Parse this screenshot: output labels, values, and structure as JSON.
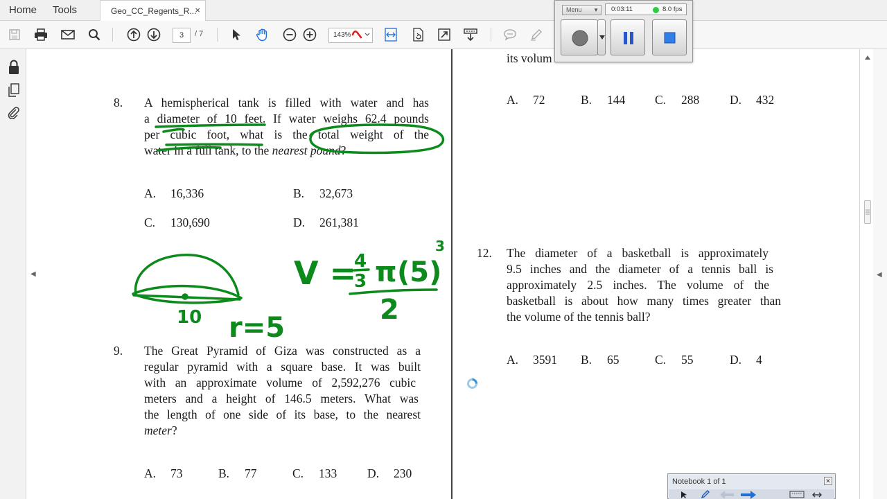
{
  "menu": {
    "home": "Home",
    "tools": "Tools"
  },
  "tab": {
    "title": "Geo_CC_Regents_R...",
    "close": "×"
  },
  "toolbar": {
    "page_current": "3",
    "page_total": "/ 7",
    "zoom": "143%"
  },
  "recorder": {
    "menu_label": "Menu",
    "elapsed": "0:03:11",
    "fps": "8.0 fps",
    "status_color": "#2ecc40"
  },
  "notebook": {
    "title": "Notebook 1 of 1"
  },
  "colors": {
    "ink_green": "#0c8a1c",
    "accent_blue": "#1e6fd9"
  },
  "questions": {
    "q8": {
      "number": "8.",
      "lines": [
        "A hemispherical tank is filled with water and has",
        "a diameter of 10 feet. If water weighs 62.4 pounds",
        "per cubic foot, what is the total weight of the"
      ],
      "last_line_prefix": "water in a full tank, to the ",
      "last_line_italic": "nearest pound",
      "last_line_suffix": "?",
      "options": [
        {
          "letter": "A.",
          "value": "16,336"
        },
        {
          "letter": "B.",
          "value": "32,673"
        },
        {
          "letter": "C.",
          "value": "130,690"
        },
        {
          "letter": "D.",
          "value": "261,381"
        }
      ]
    },
    "q9": {
      "number": "9.",
      "lines": [
        "The Great Pyramid of Giza was constructed as a",
        "regular pyramid with a square base. It was built",
        "with an approximate volume of 2,592,276 cubic",
        "meters and a height of 146.5 meters. What was",
        "the length of one side of its base, to the nearest"
      ],
      "last_line_italic": "meter",
      "last_line_suffix": "?",
      "options": [
        {
          "letter": "A.",
          "value": "73"
        },
        {
          "letter": "B.",
          "value": "77"
        },
        {
          "letter": "C.",
          "value": "133"
        },
        {
          "letter": "D.",
          "value": "230"
        }
      ]
    },
    "q11_tail": {
      "fragment": "its volum",
      "options": [
        {
          "letter": "A.",
          "value": "72"
        },
        {
          "letter": "B.",
          "value": "144"
        },
        {
          "letter": "C.",
          "value": "288"
        },
        {
          "letter": "D.",
          "value": "432"
        }
      ]
    },
    "q12": {
      "number": "12.",
      "lines": [
        "The diameter of a basketball is approximately",
        "9.5 inches and the diameter of a tennis ball is",
        "approximately 2.5 inches. The volume of the",
        "basketball is about how many times greater than"
      ],
      "last_line": "the volume of the tennis ball?",
      "options": [
        {
          "letter": "A.",
          "value": "3591"
        },
        {
          "letter": "B.",
          "value": "65"
        },
        {
          "letter": "C.",
          "value": "55"
        },
        {
          "letter": "D.",
          "value": "4"
        }
      ]
    }
  },
  "annotations": {
    "diameter_label": "10",
    "radius_label": "r=5",
    "formula_left": "V =",
    "formula_fraction_num": "4",
    "formula_fraction_den": "3",
    "formula_pi": "π",
    "formula_paren": "(5)",
    "formula_exp": "3",
    "formula_divisor": "2"
  }
}
